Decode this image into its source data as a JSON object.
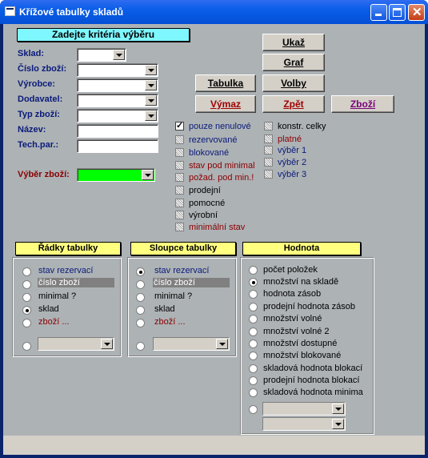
{
  "window": {
    "title": "Křížové tabulky skladů"
  },
  "criteria": {
    "heading": "Zadejte kritéria výběru",
    "fields": [
      {
        "label": "Sklad:",
        "value": ""
      },
      {
        "label": "Číslo zboží:",
        "value": ""
      },
      {
        "label": "Výrobce:",
        "value": ""
      },
      {
        "label": "Dodavatel:",
        "value": ""
      },
      {
        "label": "Typ zboží:",
        "value": ""
      },
      {
        "label": "Název:",
        "value": ""
      },
      {
        "label": "Tech.par.:",
        "value": ""
      }
    ],
    "vyber_label": "Výběr zboží:",
    "vyber_color": "#00ff00"
  },
  "buttons": {
    "ukaz": "Ukaž",
    "graf": "Graf",
    "tabulka": "Tabulka",
    "volby": "Volby",
    "vymaz": "Výmaz",
    "zpet": "Zpět",
    "zbozi": "Zboží"
  },
  "checks_left": [
    {
      "label": "pouze nenulové",
      "checked": true,
      "color": "blue"
    },
    {
      "label": "rezervované",
      "checked": false,
      "color": "blue"
    },
    {
      "label": "blokované",
      "checked": false,
      "color": "blue"
    },
    {
      "label": "stav pod minimal",
      "checked": false,
      "color": "red"
    },
    {
      "label": "požad. pod min.!",
      "checked": false,
      "color": "red"
    },
    {
      "label": "prodejní",
      "checked": false,
      "color": "black"
    },
    {
      "label": "pomocné",
      "checked": false,
      "color": "black"
    },
    {
      "label": "výrobní",
      "checked": false,
      "color": "black"
    },
    {
      "label": "minimální stav",
      "checked": false,
      "color": "red"
    }
  ],
  "checks_right": [
    {
      "label": "konstr. celky",
      "checked": false,
      "color": "black"
    },
    {
      "label": "platné",
      "checked": false,
      "color": "red"
    },
    {
      "label": "výběr 1",
      "checked": false,
      "color": "blue"
    },
    {
      "label": "výběr 2",
      "checked": false,
      "color": "blue"
    },
    {
      "label": "výběr 3",
      "checked": false,
      "color": "blue"
    }
  ],
  "radky": {
    "heading": "Řádky tabulky",
    "options": [
      "stav rezervací",
      "číslo zboží",
      "minimal ?",
      "sklad",
      "zboží ..."
    ],
    "selected": 3
  },
  "sloupce": {
    "heading": "Sloupce tabulky",
    "options": [
      "stav rezervací",
      "číslo zboží",
      "minimal ?",
      "sklad",
      "zboží ..."
    ],
    "selected": 0
  },
  "hodnota": {
    "heading": "Hodnota",
    "options": [
      "počet položek",
      "množství na skladě",
      "hodnota zásob",
      "prodejní hodnota zásob",
      "množství volné",
      "množství volné 2",
      "množství dostupné",
      "množství blokované",
      "skladová hodnota blokací",
      "prodejní hodnota blokací",
      "skladová hodnota minima"
    ],
    "selected": 1
  }
}
